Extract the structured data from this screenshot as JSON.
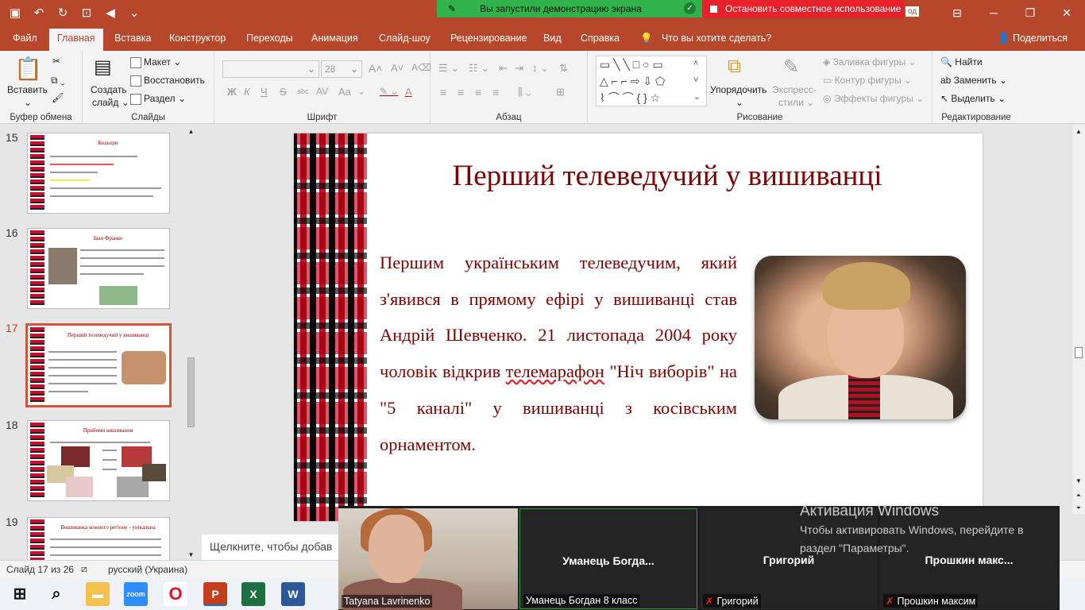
{
  "titlebar": {
    "share_status": "Вы запустили демонстрацию экрана",
    "stop_share": "Остановить совместное использование",
    "od_label": "од"
  },
  "tabs": [
    "Файл",
    "Главная",
    "Вставка",
    "Конструктор",
    "Переходы",
    "Анимация",
    "Слайд-шоу",
    "Рецензирование",
    "Вид",
    "Справка"
  ],
  "tell_me": "Что вы хотите сделать?",
  "share": "Поделиться",
  "ribbon": {
    "clipboard": {
      "paste": "Вставить",
      "label": "Буфер обмена"
    },
    "slides": {
      "new_slide_1": "Создать",
      "new_slide_2": "слайд",
      "layout": "Макет",
      "reset": "Восстановить",
      "section": "Раздел",
      "label": "Слайды"
    },
    "font": {
      "size": "28",
      "bold": "Ж",
      "italic": "К",
      "underline": "Ч",
      "strike": "S",
      "spacing": "abc",
      "spacing2": "AV",
      "case": "Aa",
      "color": "A",
      "label": "Шрифт"
    },
    "paragraph": {
      "label": "Абзац"
    },
    "drawing": {
      "arrange": "Упорядочить",
      "quick1": "Экспресс-",
      "quick2": "стили",
      "fill": "Заливка фигуры",
      "outline": "Контур фигуры",
      "effects": "Эффекты фигуры",
      "label": "Рисование"
    },
    "editing": {
      "find": "Найти",
      "replace": "Заменить",
      "select": "Выделить",
      "label": "Редактирование"
    }
  },
  "thumbnails": [
    {
      "num": "15",
      "title": "Кольори"
    },
    {
      "num": "16",
      "title": "Іван Франко"
    },
    {
      "num": "17",
      "title": "Перший телеведучий у вишиванці"
    },
    {
      "num": "18",
      "title": "Прийоми вишивання"
    },
    {
      "num": "19",
      "title": "Вишиванка кожного регіону - унікальна"
    }
  ],
  "slide": {
    "title": "Перший телеведучий у вишиванці",
    "body_1": "Першим українським телеведучим, який з'явився в прямому ефірі у вишиванці став Андрій Шевченко. 21 листопада 2004 року чоловік відкрив ",
    "body_underlined": "телемарафон",
    "body_2": " \"Ніч виборів\" на \"5 каналі\" у вишиванці з косівським орнаментом."
  },
  "notes_placeholder": "Щелкните, чтобы добав",
  "status": {
    "slide": "Слайд 17 из 26",
    "lang": "русский (Украина)"
  },
  "zoom": {
    "tiles": [
      {
        "name": "",
        "label": "Tatyana Lavrinenko",
        "muted": false
      },
      {
        "name": "Уманець Богда...",
        "label": "Уманець Богдан 8 класс",
        "muted": false
      },
      {
        "name": "Григорий",
        "label": "Григорий",
        "muted": true
      },
      {
        "name": "Прошкин макс...",
        "label": "Прошкин максим",
        "muted": true
      }
    ]
  },
  "activation": {
    "title": "Активация Windows",
    "line1": "Чтобы активировать Windows, перейдите в",
    "line2": "раздел \"Параметры\"."
  },
  "taskbar": [
    "Windows",
    "Поиск",
    "Проводник",
    "Zoom",
    "Opera",
    "PowerPoint",
    "Excel",
    "Word"
  ],
  "colors": {
    "accent": "#b7472a",
    "slide_text": "#7f0000",
    "share_green": "#2fb34a",
    "stop_red": "#e8202a"
  }
}
